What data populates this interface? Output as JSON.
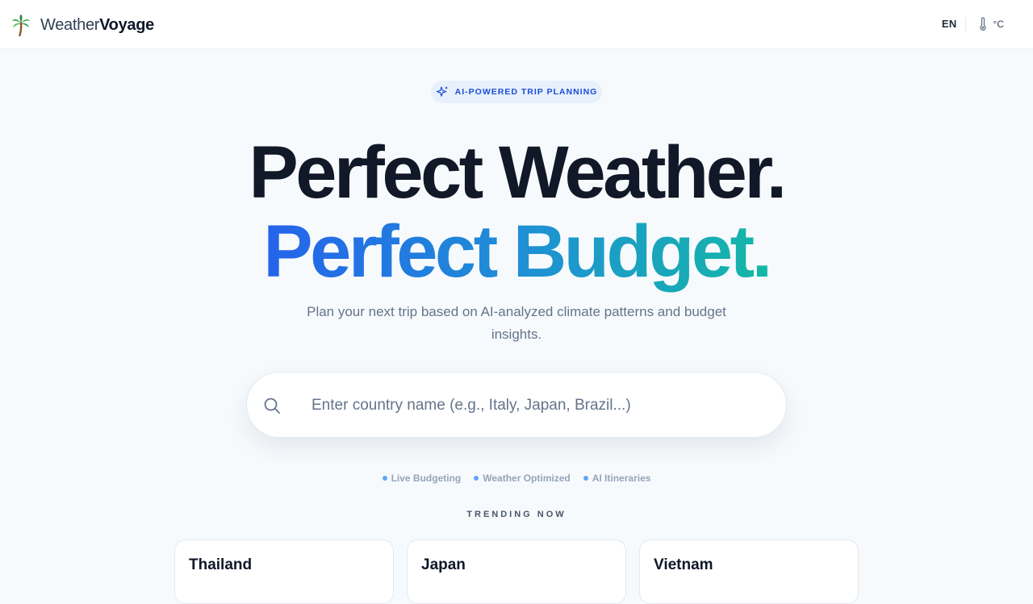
{
  "brand": {
    "name_light": "Weather",
    "name_bold": "Voyage",
    "logo": "palm-tree-icon"
  },
  "header": {
    "language": "EN",
    "unit_icon": "thermometer-icon",
    "unit": "°C"
  },
  "badge": {
    "icon": "sparkle-icon",
    "text": "AI-POWERED TRIP PLANNING"
  },
  "hero": {
    "line1": "Perfect Weather.",
    "line2": "Perfect Budget.",
    "subtitle": "Plan your next trip based on AI-analyzed climate patterns and budget insights."
  },
  "search": {
    "icon": "search-icon",
    "value": "",
    "placeholder": "Enter country name (e.g., Italy, Japan, Brazil...)"
  },
  "features": [
    "Live Budgeting",
    "Weather Optimized",
    "AI Itineraries"
  ],
  "trending": {
    "label": "TRENDING NOW",
    "destinations": [
      "Thailand",
      "Japan",
      "Vietnam"
    ]
  },
  "colors": {
    "accent_blue": "#2563eb",
    "accent_teal": "#14b8a6",
    "badge_bg": "#e7f0fb",
    "feature_dot": "#60a5fa"
  }
}
